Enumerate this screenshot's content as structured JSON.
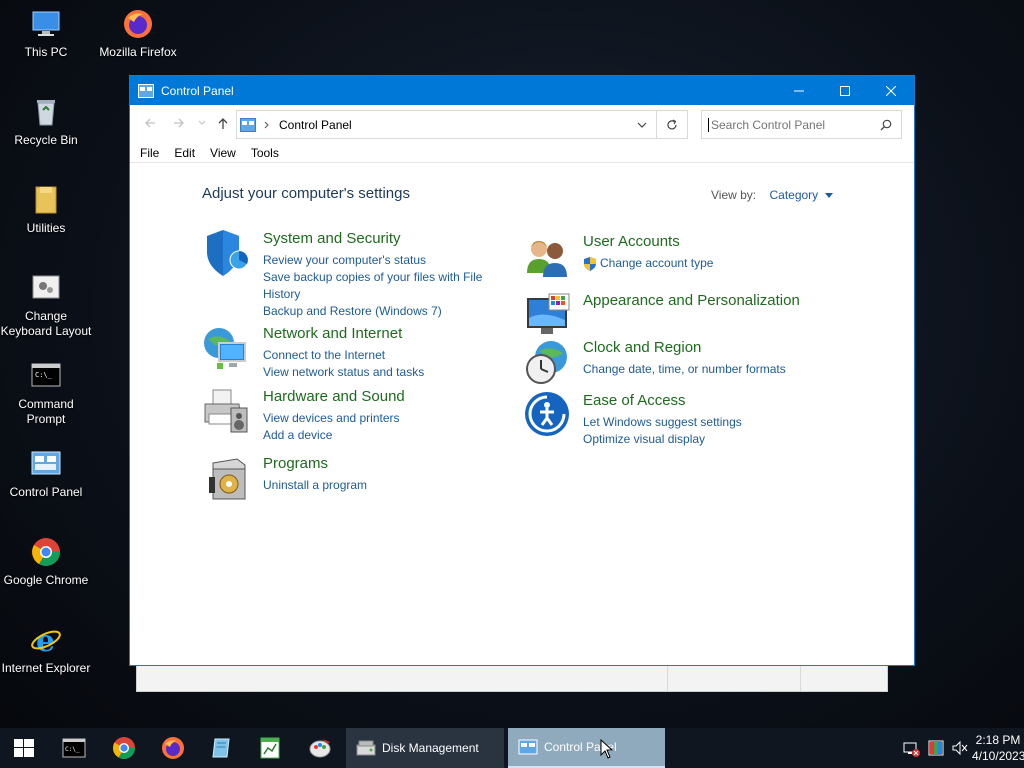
{
  "desktop": {
    "icons": [
      {
        "label": "This PC"
      },
      {
        "label": "Mozilla Firefox"
      },
      {
        "label": "Recycle Bin"
      },
      {
        "label": "Utilities"
      },
      {
        "label": "Change Keyboard Layout"
      },
      {
        "label": "Command Prompt"
      },
      {
        "label": "Control Panel"
      },
      {
        "label": "Google Chrome"
      },
      {
        "label": "Internet Explorer"
      }
    ]
  },
  "window": {
    "title": "Control Panel",
    "address": {
      "path": "Control Panel"
    },
    "search": {
      "placeholder": "Search Control Panel"
    },
    "menu": [
      "File",
      "Edit",
      "View",
      "Tools"
    ],
    "heading": "Adjust your computer's settings",
    "view_by": {
      "label": "View by:",
      "value": "Category"
    },
    "categories": [
      {
        "title": "System and Security",
        "icon": "shield-icon",
        "links": [
          "Review your computer's status",
          "Save backup copies of your files with File",
          "History",
          "Backup and Restore (Windows 7)"
        ]
      },
      {
        "title": "Network and Internet",
        "icon": "network-globe-icon",
        "links": [
          "Connect to the Internet",
          "View network status and tasks"
        ]
      },
      {
        "title": "Hardware and Sound",
        "icon": "printer-icon",
        "links": [
          "View devices and printers",
          "Add a device"
        ]
      },
      {
        "title": "Programs",
        "icon": "programs-box-icon",
        "links": [
          "Uninstall a program"
        ]
      },
      {
        "title": "User Accounts",
        "icon": "users-icon",
        "links": [
          "Change account type"
        ]
      },
      {
        "title": "Appearance and Personalization",
        "icon": "monitor-palette-icon",
        "links": []
      },
      {
        "title": "Clock and Region",
        "icon": "clock-globe-icon",
        "links": [
          "Change date, time, or number formats"
        ]
      },
      {
        "title": "Ease of Access",
        "icon": "ease-of-access-icon",
        "links": [
          "Let Windows suggest settings",
          "Optimize visual display"
        ]
      }
    ]
  },
  "taskbar": {
    "tasks": [
      {
        "label": "Disk Management"
      },
      {
        "label": "Control Panel"
      }
    ],
    "clock": {
      "time": "2:18 PM",
      "date": "4/10/2023"
    }
  },
  "colors": {
    "titlebar": "#0078d7",
    "link": "#1e5b99",
    "category_title": "#1e6b1e"
  }
}
